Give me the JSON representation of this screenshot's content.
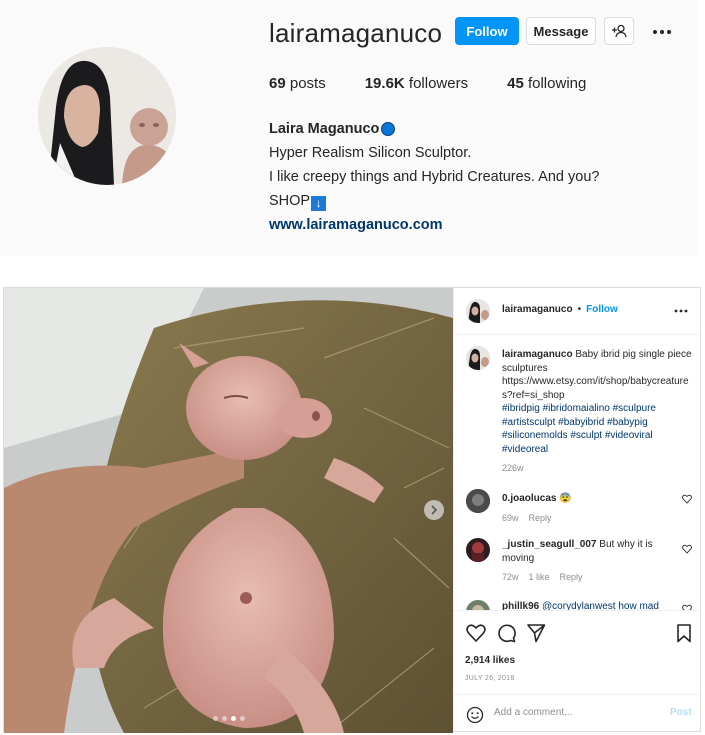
{
  "profile": {
    "username": "lairamaganuco",
    "follow_label": "Follow",
    "message_label": "Message",
    "posts_count": "69",
    "posts_label": " posts",
    "followers_count": "19.6K",
    "followers_label": " followers",
    "following_count": "45",
    "following_label": " following",
    "full_name": "Laira Maganuco",
    "bio_line1": "Hyper Realism Silicon Sculptor.",
    "bio_line2": "I like creepy things and Hybrid Creatures. And you?",
    "bio_shop": "SHOP",
    "website": "www.lairamaganuco.com"
  },
  "post": {
    "author": "lairamaganuco",
    "separator": "•",
    "follow_label": "Follow",
    "caption_author": "lairamaganuco",
    "caption_text": " Baby ibrid pig single piece sculptures https://www.etsy.com/it/shop/babycreatures?ref=si_shop",
    "hashtags": "#ibridpig #ibridomaialino #sculpure #artistsculpt #babyibrid #babypig #siliconemolds #sculpt #videoviral #videoreal",
    "caption_age": "226w",
    "comments": [
      {
        "user": "0.joaolucas",
        "text": " 😨",
        "age": "69w",
        "likes": "",
        "reply": "Reply"
      },
      {
        "user": "_justin_seagull_007",
        "text": " But why it is moving",
        "age": "72w",
        "likes": "1 like",
        "reply": "Reply"
      },
      {
        "user": "phillk96",
        "text": " @corydylanwest how mad",
        "age": "",
        "likes": "",
        "reply": ""
      }
    ],
    "likes": "2,914 likes",
    "date": "JULY 26, 2018",
    "comment_placeholder": "Add a comment...",
    "post_label": "Post",
    "carousel_dots": 4,
    "active_dot": 2
  },
  "colors": {
    "primary_blue": "#0095f6",
    "link_blue": "#00376b",
    "muted_text": "#8e8e8e",
    "border": "#dbdbdb"
  }
}
